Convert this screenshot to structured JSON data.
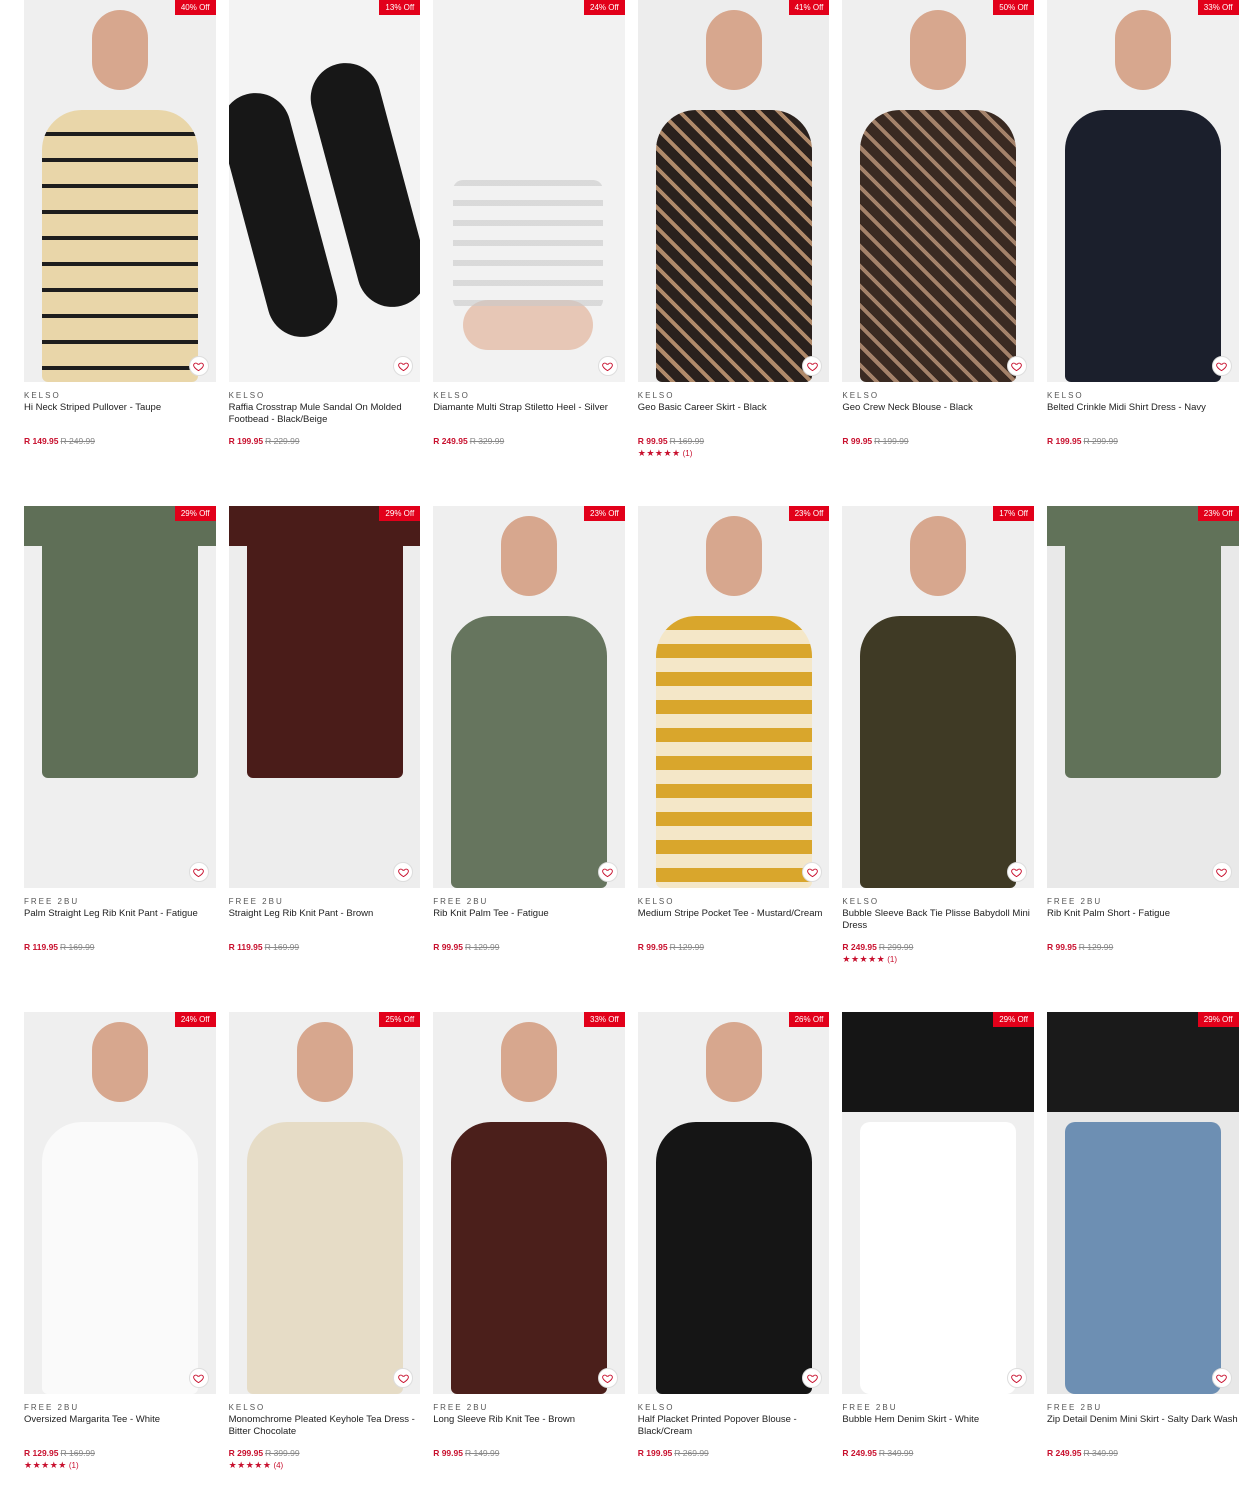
{
  "colors": {
    "accent": "#e2001a",
    "price": "#c8102e"
  },
  "products": [
    {
      "badge": "40% Off",
      "brand": "KELSO",
      "name": "Hi Neck Striped Pullover - Taupe",
      "price": "R 149.95",
      "was": "R 249.99",
      "stars": "",
      "reviews": "",
      "swatch": {
        "bg": "#efefef",
        "main": "#e9d6a9",
        "accent": "#1d1d1d"
      }
    },
    {
      "badge": "13% Off",
      "brand": "KELSO",
      "name": "Raffia Crosstrap Mule Sandal On Molded Footbead - Black/Beige",
      "price": "R 199.95",
      "was": "R 229.99",
      "stars": "",
      "reviews": "",
      "swatch": {
        "bg": "#f3f3f3",
        "main": "#171717",
        "accent": "#d8c79c"
      }
    },
    {
      "badge": "24% Off",
      "brand": "KELSO",
      "name": "Diamante Multi Strap Stiletto Heel - Silver",
      "price": "R 249.95",
      "was": "R 329.99",
      "stars": "",
      "reviews": "",
      "swatch": {
        "bg": "#f2f2f2",
        "main": "#e7c7b6",
        "accent": "#c9c9c9"
      }
    },
    {
      "badge": "41% Off",
      "brand": "KELSO",
      "name": "Geo Basic Career Skirt - Black",
      "price": "R 99.95",
      "was": "R 169.99",
      "stars": "★★★★★",
      "reviews": "(1)",
      "swatch": {
        "bg": "#ededed",
        "main": "#2a211d",
        "accent": "#b08a6a"
      }
    },
    {
      "badge": "50% Off",
      "brand": "KELSO",
      "name": "Geo Crew Neck Blouse - Black",
      "price": "R 99.95",
      "was": "R 199.99",
      "stars": "",
      "reviews": "",
      "swatch": {
        "bg": "#efefef",
        "main": "#3a2a22",
        "accent": "#a4826a"
      }
    },
    {
      "badge": "33% Off",
      "brand": "KELSO",
      "name": "Belted Crinkle Midi Shirt Dress - Navy",
      "price": "R 199.95",
      "was": "R 299.99",
      "stars": "",
      "reviews": "",
      "swatch": {
        "bg": "#f0f0f0",
        "main": "#1b1f2c",
        "accent": "#cfa6a0"
      }
    },
    {
      "badge": "29% Off",
      "brand": "FREE 2BU",
      "name": "Palm Straight Leg Rib Knit Pant - Fatigue",
      "price": "R 119.95",
      "was": "R 169.99",
      "stars": "",
      "reviews": "",
      "swatch": {
        "bg": "#efefef",
        "main": "#5f6f57",
        "accent": "#d8dcd0"
      }
    },
    {
      "badge": "29% Off",
      "brand": "FREE 2BU",
      "name": "Straight Leg Rib Knit Pant - Brown",
      "price": "R 119.95",
      "was": "R 169.99",
      "stars": "",
      "reviews": "",
      "swatch": {
        "bg": "#ededed",
        "main": "#4a1c19",
        "accent": "#d9a892"
      }
    },
    {
      "badge": "23% Off",
      "brand": "FREE 2BU",
      "name": "Rib Knit Palm Tee - Fatigue",
      "price": "R 99.95",
      "was": "R 129.99",
      "stars": "",
      "reviews": "",
      "swatch": {
        "bg": "#efefef",
        "main": "#66755e",
        "accent": "#d9b19a"
      }
    },
    {
      "badge": "23% Off",
      "brand": "KELSO",
      "name": "Medium Stripe Pocket Tee - Mustard/Cream",
      "price": "R 99.95",
      "was": "R 129.99",
      "stars": "",
      "reviews": "",
      "swatch": {
        "bg": "#efefef",
        "main": "#d9a62c",
        "accent": "#f4e7c8"
      }
    },
    {
      "badge": "17% Off",
      "brand": "KELSO",
      "name": "Bubble Sleeve Back Tie Plisse Babydoll Mini Dress",
      "price": "R 249.95",
      "was": "R 299.99",
      "stars": "★★★★★",
      "reviews": "(1)",
      "swatch": {
        "bg": "#efefef",
        "main": "#3f3a25",
        "accent": "#d7a5c2"
      }
    },
    {
      "badge": "23% Off",
      "brand": "FREE 2BU",
      "name": "Rib Knit Palm Short - Fatigue",
      "price": "R 99.95",
      "was": "R 129.99",
      "stars": "",
      "reviews": "",
      "swatch": {
        "bg": "#e9e9e9",
        "main": "#617259",
        "accent": "#d8ddd2"
      }
    },
    {
      "badge": "24% Off",
      "brand": "FREE 2BU",
      "name": "Oversized Margarita Tee - White",
      "price": "R 129.95",
      "was": "R 169.99",
      "stars": "★★★★★",
      "reviews": "(1)",
      "swatch": {
        "bg": "#efefef",
        "main": "#fafafa",
        "accent": "#3256b5"
      }
    },
    {
      "badge": "25% Off",
      "brand": "KELSO",
      "name": "Monomchrome Pleated Keyhole Tea Dress - Bitter Chocolate",
      "price": "R 299.95",
      "was": "R 399.99",
      "stars": "★★★★★",
      "reviews": "(4)",
      "swatch": {
        "bg": "#efefef",
        "main": "#e6dcc6",
        "accent": "#5a221b"
      }
    },
    {
      "badge": "33% Off",
      "brand": "FREE 2BU",
      "name": "Long Sleeve Rib Knit Tee - Brown",
      "price": "R 99.95",
      "was": "R 149.99",
      "stars": "",
      "reviews": "",
      "swatch": {
        "bg": "#efefef",
        "main": "#4b1f1b",
        "accent": "#d8ab95"
      }
    },
    {
      "badge": "26% Off",
      "brand": "KELSO",
      "name": "Half Placket Printed Popover Blouse - Black/Cream",
      "price": "R 199.95",
      "was": "R 269.99",
      "stars": "",
      "reviews": "",
      "swatch": {
        "bg": "#efefef",
        "main": "#151515",
        "accent": "#eee3cc"
      }
    },
    {
      "badge": "29% Off",
      "brand": "FREE 2BU",
      "name": "Bubble Hem Denim Skirt - White",
      "price": "R 249.95",
      "was": "R 349.99",
      "stars": "",
      "reviews": "",
      "swatch": {
        "bg": "#efefef",
        "main": "#ffffff",
        "accent": "#151515"
      }
    },
    {
      "badge": "29% Off",
      "brand": "FREE 2BU",
      "name": "Zip Detail Denim Mini Skirt - Salty Dark Wash",
      "price": "R 249.95",
      "was": "R 349.99",
      "stars": "",
      "reviews": "",
      "swatch": {
        "bg": "#e8e8e8",
        "main": "#6d8fb3",
        "accent": "#1a1a1a"
      }
    }
  ]
}
